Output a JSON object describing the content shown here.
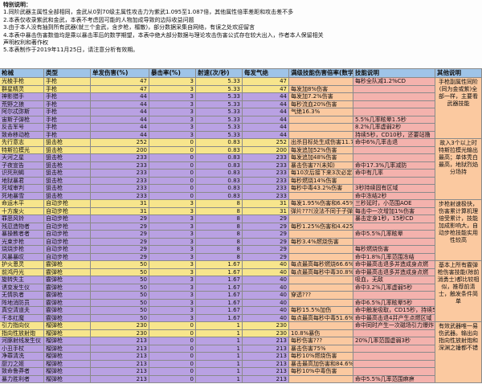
{
  "colors": {
    "yellow": "#f7e58c",
    "purple": "#b9a1e3",
    "pink": "#f4b2ad",
    "peach": "#fbc9a0",
    "header": "#9fc4e8",
    "border": "#8a8a8a"
  },
  "notes": {
    "title": "特别说明：",
    "lines": [
      "1.同阶武器主属性全部相同，金武从0到70级主属性攻击力为紫武1.095至1.087倍，其他属性倍率差距和攻击差不多",
      "2.本表仅收录紫武和金武，本表不考虑因可能的人物加成导致的边际收益问题",
      "3.由于本人没有抽到所有武器(就三个金武，含步枪，榴散)，部分数据采集自网络，有误之处欢迎留言",
      "4.本表中暴击伤害数值均是乘以暴击率后的数学期望，本表中绝大部分数据与理论攻击伤害公式存在较大出入，作者本人保留相关",
      "声明权利和著作权",
      "5.本表制作于2019年11月25日，请注意分析有效期。"
    ]
  },
  "headers": [
    "枪械",
    "类型",
    "单发伤害(%)",
    "暴击率(%)",
    "射速(次/秒)",
    "每发气绝",
    "满级技能伤害倍率(数学期望)",
    "技能说明",
    "其他说明"
  ],
  "weapons": [
    {
      "name": "光棱手枪",
      "type": "手枪",
      "dmg": "47",
      "crit": "3",
      "rate": "5.33",
      "stun": "47",
      "mult": "",
      "skill": "每秒全队减1.2%CD",
      "color": "yellow"
    },
    {
      "name": "群星精灵",
      "type": "手枪",
      "dmg": "47",
      "crit": "3",
      "rate": "5.33",
      "stun": "47",
      "mult": "每发加8%伤害",
      "skill": "",
      "color": "yellow"
    },
    {
      "name": "神影猎手",
      "type": "手枪",
      "dmg": "44",
      "crit": "3",
      "rate": "5.33",
      "stun": "44",
      "mult": "每发加7.2%伤害",
      "skill": "",
      "color": "purple"
    },
    {
      "name": "荒野之狼",
      "type": "手枪",
      "dmg": "44",
      "crit": "3",
      "rate": "5.33",
      "stun": "44",
      "mult": "每秒流血20%伤害",
      "skill": "",
      "color": "purple"
    },
    {
      "name": "阿尔忒弥斯",
      "type": "手枪",
      "dmg": "44",
      "crit": "3",
      "rate": "5.33",
      "stun": "44",
      "mult": "气绝16.3%",
      "skill": "",
      "color": "purple"
    },
    {
      "name": "宙斯子弹枪",
      "type": "手枪",
      "dmg": "44",
      "crit": "3",
      "rate": "5.33",
      "stun": "44",
      "mult": "",
      "skill": "5.5%几率眩晕1.5秒",
      "color": "purple"
    },
    {
      "name": "反击军号",
      "type": "手枪",
      "dmg": "44",
      "crit": "3",
      "rate": "5.33",
      "stun": "44",
      "mult": "",
      "skill": "8.2%几率虚弱2秒",
      "color": "purple"
    },
    {
      "name": "致命移动枪",
      "type": "手枪",
      "dmg": "44",
      "crit": "3",
      "rate": "5.33",
      "stun": "44",
      "mult": "",
      "skill": "持续5秒，CD10秒，还要站撸",
      "color": "purple"
    },
    {
      "name": "先行意志",
      "type": "狙击枪",
      "dmg": "252",
      "crit": "0",
      "rate": "0.83",
      "stun": "252",
      "mult": "出杀目标处生成伤害11.7%区域",
      "skill": "命中6%几率击退",
      "color": "yellow"
    },
    {
      "name": "特斯拉模光",
      "type": "狙击枪",
      "dmg": "200",
      "crit": "0",
      "rate": "0.83",
      "stun": "200",
      "mult": "每发追加52%伤害",
      "skill": "",
      "color": "yellow"
    },
    {
      "name": "天河之星",
      "type": "狙击枪",
      "dmg": "233",
      "crit": "0",
      "rate": "0.83",
      "stun": "233",
      "mult": "每发追加48%伤害",
      "skill": "",
      "color": "purple"
    },
    {
      "name": "子夜宣告",
      "type": "狙击枪",
      "dmg": "233",
      "crit": "0",
      "rate": "0.83",
      "stun": "233",
      "mult": "暴击伤害??(未知)",
      "skill": "命中17.3%几率减防",
      "color": "purple"
    },
    {
      "name": "识死刑蝎",
      "type": "狙击枪",
      "dmg": "233",
      "crit": "0",
      "rate": "0.83",
      "stun": "233",
      "mult": "每10次后接下来3次必定暴击",
      "skill": "命中有几率",
      "color": "purple"
    },
    {
      "name": "地狱暴君",
      "type": "狙击枪",
      "dmg": "233",
      "crit": "0",
      "rate": "0.83",
      "stun": "233",
      "mult": "每秒燃烧14%伤害",
      "skill": "",
      "color": "purple"
    },
    {
      "name": "死域审判",
      "type": "狙击枪",
      "dmg": "233",
      "crit": "0",
      "rate": "0.83",
      "stun": "233",
      "mult": "每秒中毒43.2%伤害",
      "skill": "3秒持续固有区域",
      "color": "purple"
    },
    {
      "name": "死地暴雪",
      "type": "狙击枪",
      "dmg": "233",
      "crit": "0",
      "rate": "0.83",
      "stun": "233",
      "mult": "",
      "skill": "命中冻结2秒",
      "color": "purple"
    },
    {
      "name": "命运木平",
      "type": "自动步枪",
      "dmg": "31",
      "crit": "3",
      "rate": "8",
      "stun": "31",
      "mult": "每发1.95%伤害和6.45%气绝",
      "skill": "三秒延时，小范围AOE",
      "color": "yellow"
    },
    {
      "name": "十方废火",
      "type": "自动步枪",
      "dmg": "31",
      "crit": "3",
      "rate": "8",
      "stun": "31",
      "mult": "弹片???(没法不同于子弹)",
      "skill": "每击中一次增加1%伤害",
      "color": "yellow"
    },
    {
      "name": "罪恶风铃",
      "type": "自动步枪",
      "dmg": "29",
      "crit": "3",
      "rate": "8",
      "stun": "29",
      "mult": "",
      "skill": "暴击定身1秒，15秒CD",
      "color": "purple"
    },
    {
      "name": "残忍造物者",
      "type": "自动步枪",
      "dmg": "29",
      "crit": "3",
      "rate": "8",
      "stun": "29",
      "mult": "每秒1.25%伤害和4.425%气绝",
      "skill": "",
      "color": "purple"
    },
    {
      "name": "暴操教者者",
      "type": "自动步枪",
      "dmg": "29",
      "crit": "3",
      "rate": "8",
      "stun": "29",
      "mult": "",
      "skill": "命中5.5%几率眩晕",
      "color": "purple"
    },
    {
      "name": "光束步枪",
      "type": "自动步枪",
      "dmg": "29",
      "crit": "3",
      "rate": "8",
      "stun": "29",
      "mult": "每秒3.4%燃烧伤害",
      "skill": "",
      "color": "purple"
    },
    {
      "name": "烧烧步枪",
      "type": "自动步枪",
      "dmg": "29",
      "crit": "3",
      "rate": "8",
      "stun": "29",
      "mult": "",
      "skill": "每秒燃烧伤害",
      "color": "purple"
    },
    {
      "name": "风暴暴叹",
      "type": "自动步枪",
      "dmg": "29",
      "crit": "3",
      "rate": "8",
      "stun": "29",
      "mult": "",
      "skill": "命中1.8%几率范围冻结",
      "color": "purple"
    },
    {
      "name": "护火恩灵",
      "type": "霰弹枪",
      "dmg": "50",
      "crit": "3",
      "rate": "1.67",
      "stun": "40",
      "mult": "每点最高每秒燃烧66.6%伤害",
      "skill": "命中最高击退多并造成身点燃",
      "color": "yellow"
    },
    {
      "name": "前鸿丹光",
      "type": "霰弹枪",
      "dmg": "50",
      "crit": "3",
      "rate": "1.67",
      "stun": "40",
      "mult": "每点最高每秒中毒30.8%伤害",
      "skill": "命中最高击退多并造成身点燃",
      "color": "yellow"
    },
    {
      "name": "旋转失主",
      "type": "霰弹枪",
      "dmg": "50",
      "crit": "3",
      "rate": "1.67",
      "stun": "40",
      "mult": "",
      "skill": "吸血，无敌",
      "color": "purple"
    },
    {
      "name": "诱变发生仪",
      "type": "霰弹枪",
      "dmg": "50",
      "crit": "3",
      "rate": "1.67",
      "stun": "40",
      "mult": "",
      "skill": "命中3.2%几率虚弱5秒",
      "color": "purple"
    },
    {
      "name": "无情执者",
      "type": "霰弹枪",
      "dmg": "50",
      "crit": "3",
      "rate": "1.67",
      "stun": "40",
      "mult": "穿透???",
      "skill": "",
      "color": "purple"
    },
    {
      "name": "阵地消防员",
      "type": "霰弹枪",
      "dmg": "50",
      "crit": "3",
      "rate": "1.67",
      "stun": "40",
      "mult": "",
      "skill": "命中6.5%几率眩晕5秒",
      "color": "purple"
    },
    {
      "name": "真空清道夫",
      "type": "霰弹枪",
      "dmg": "50",
      "crit": "3",
      "rate": "1.67",
      "stun": "40",
      "mult": "每秒15.5%加伤",
      "skill": "命中触发吸取，CD15秒，持续5秒",
      "color": "purple"
    },
    {
      "name": "千本红魔",
      "type": "霰弹枪",
      "dmg": "50",
      "crit": "3",
      "rate": "1.67",
      "stun": "40",
      "mult": "每点最高每秒中毒51.6%伤害",
      "skill": "命中最高击退4并产生点燃区域",
      "color": "purple"
    },
    {
      "name": "引力指向仪",
      "type": "榴弹枪",
      "dmg": "230",
      "crit": "0",
      "rate": "1",
      "stun": "230",
      "mult": "",
      "skill": "命中同时产生一次磁场引力爆炸",
      "color": "yellow"
    },
    {
      "name": "指向性放射炮",
      "type": "榴弹枪",
      "dmg": "230",
      "crit": "0",
      "rate": "1",
      "stun": "230",
      "mult": "10.8%暴伤",
      "skill": "",
      "color": "yellow"
    },
    {
      "name": "河豚射线发生仪",
      "type": "榴弹枪",
      "dmg": "213",
      "crit": "0",
      "rate": "1",
      "stun": "213",
      "mult": "每秒伤害???",
      "skill": "20%几率范围虚弱3秒",
      "color": "purple"
    },
    {
      "name": "小丑手杖",
      "type": "榴弹枪",
      "dmg": "213",
      "crit": "0",
      "rate": "1",
      "stun": "213",
      "mult": "暴击伤害75%",
      "skill": "",
      "color": "purple"
    },
    {
      "name": "净罪清洗",
      "type": "榴弹枪",
      "dmg": "213",
      "crit": "0",
      "rate": "1",
      "stun": "213",
      "mult": "每秒10%燃烧伤害",
      "skill": "",
      "color": "purple"
    },
    {
      "name": "厨刀之姬",
      "type": "榴弹枪",
      "dmg": "213",
      "crit": "0",
      "rate": "1",
      "stun": "213",
      "mult": "暴击最高加伤害和84.6%气绝",
      "skill": "",
      "color": "purple"
    },
    {
      "name": "致命鲁莽者",
      "type": "榴弹枪",
      "dmg": "213",
      "crit": "0",
      "rate": "1",
      "stun": "213",
      "mult": "每秒10%中毒伤害",
      "skill": "",
      "color": "purple"
    },
    {
      "name": "暴力胜利者",
      "type": "榴弹枪",
      "dmg": "213",
      "crit": "0",
      "rate": "1",
      "stun": "213",
      "mult": "",
      "skill": "命中5.5%几率范围麻痹",
      "color": "purple"
    }
  ],
  "other_notes": [
    {
      "text": "手枪副属性同阶(同为金或紫)全部一样，主要看武器技能",
      "start": 0,
      "span": 8
    },
    {
      "text": "故入3个以上时特斯拉模光输出最高；单体秃白最高，地狱烈焰分场持",
      "start": 8,
      "span": 8
    },
    {
      "text": "步枪射速极快，伤害累计算机理倍受累计，技能加成影响大，自动步枪技能实用性较高",
      "start": 16,
      "span": 8
    },
    {
      "text": "基本上所有霰弹枪伤害技能(除前消勇士)都比较相似，推荐前清士，触发条件简单",
      "start": 24,
      "span": 8
    },
    {
      "text": "有效武器唯一易伤武器。输出向指向性放射炮和深渊之锤都不错",
      "start": 32,
      "span": 8
    }
  ]
}
